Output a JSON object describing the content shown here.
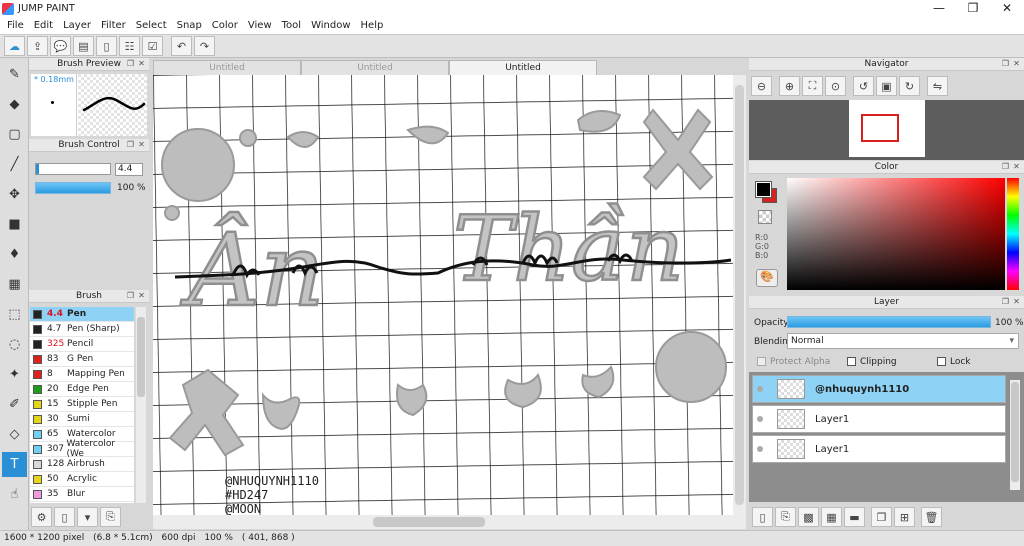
{
  "app": {
    "title": "JUMP PAINT"
  },
  "window_controls": {
    "minimize": "—",
    "maximize": "❐",
    "close": "✕"
  },
  "menu": [
    "File",
    "Edit",
    "Layer",
    "Filter",
    "Select",
    "Snap",
    "Color",
    "View",
    "Tool",
    "Window",
    "Help"
  ],
  "toolbar": {
    "icons": [
      "cloud-check-icon",
      "export-icon",
      "speech-bubble-icon",
      "comment-icon",
      "page-icon",
      "list-settings-icon",
      "checklist-icon",
      "undo-icon",
      "redo-icon"
    ]
  },
  "tools": [
    {
      "icon": "brush-icon",
      "glyph": "✎",
      "active": false
    },
    {
      "icon": "eraser-icon",
      "glyph": "◆",
      "active": false
    },
    {
      "icon": "rectangle-select-icon",
      "glyph": "▢",
      "active": false
    },
    {
      "icon": "line-icon",
      "glyph": "╱",
      "active": false
    },
    {
      "icon": "move-icon",
      "glyph": "✥",
      "active": false
    },
    {
      "icon": "fill-rect-icon",
      "glyph": "■",
      "active": false
    },
    {
      "icon": "bucket-icon",
      "glyph": "♦",
      "active": false
    },
    {
      "icon": "gradient-icon",
      "glyph": "▦",
      "active": false
    },
    {
      "icon": "select-rect-icon",
      "glyph": "⬚",
      "active": false
    },
    {
      "icon": "lasso-icon",
      "glyph": "◌",
      "active": false
    },
    {
      "icon": "magic-wand-icon",
      "glyph": "✦",
      "active": false
    },
    {
      "icon": "select-pen-icon",
      "glyph": "✐",
      "active": false
    },
    {
      "icon": "select-eraser-icon",
      "glyph": "◇",
      "active": false
    },
    {
      "icon": "text-icon",
      "glyph": "T",
      "active": true
    },
    {
      "icon": "hand-icon",
      "glyph": "☝",
      "active": false
    }
  ],
  "brush_preview": {
    "title": "Brush Preview",
    "size": "* 0.18mm"
  },
  "brush_control": {
    "title": "Brush Control",
    "size_value": "4.4",
    "opacity_value": "100 %"
  },
  "brush": {
    "title": "Brush",
    "items": [
      {
        "size": "4.4",
        "name": "Pen",
        "color": "#222222",
        "selected": true,
        "size_red": true
      },
      {
        "size": "4.7",
        "name": "Pen (Sharp)",
        "color": "#222222",
        "selected": false,
        "size_red": false
      },
      {
        "size": "325",
        "name": "Pencil",
        "color": "#222222",
        "selected": false,
        "size_red": true
      },
      {
        "size": "83",
        "name": "G Pen",
        "color": "#e0201a",
        "selected": false,
        "size_red": false
      },
      {
        "size": "8",
        "name": "Mapping Pen",
        "color": "#e0201a",
        "selected": false,
        "size_red": false
      },
      {
        "size": "20",
        "name": "Edge Pen",
        "color": "#1a9e1a",
        "selected": false,
        "size_red": false
      },
      {
        "size": "15",
        "name": "Stipple Pen",
        "color": "#e6d61a",
        "selected": false,
        "size_red": false
      },
      {
        "size": "30",
        "name": "Sumi",
        "color": "#e6d61a",
        "selected": false,
        "size_red": false
      },
      {
        "size": "65",
        "name": "Watercolor",
        "color": "#6fd0f0",
        "selected": false,
        "size_red": false
      },
      {
        "size": "307",
        "name": "Watercolor (We",
        "color": "#6fd0f0",
        "selected": false,
        "size_red": false
      },
      {
        "size": "128",
        "name": "Airbrush",
        "color": "#d8d8d8",
        "selected": false,
        "size_red": false
      },
      {
        "size": "50",
        "name": "Acrylic",
        "color": "#e6d61a",
        "selected": false,
        "size_red": false
      },
      {
        "size": "35",
        "name": "Blur",
        "color": "#f09be0",
        "selected": false,
        "size_red": false
      }
    ]
  },
  "tabs": [
    {
      "label": "Untitled",
      "active": false
    },
    {
      "label": "Untitled",
      "active": false
    },
    {
      "label": "Untitled",
      "active": true
    }
  ],
  "canvas": {
    "big_text_1": "Ân",
    "big_text_2": "Thần",
    "stamp_lines": [
      "@NHUQUYNH1110",
      "#HD247",
      "@MOON"
    ]
  },
  "navigator": {
    "title": "Navigator"
  },
  "color": {
    "title": "Color",
    "r": "R:0",
    "g": "G:0",
    "b": "B:0",
    "foreground": "#000000",
    "background": "#d42222"
  },
  "layer": {
    "title": "Layer",
    "opacity_label": "Opacity",
    "opacity_value": "100 %",
    "blending_label": "Blending",
    "blending_value": "Normal",
    "protect_alpha": "Protect Alpha",
    "clipping": "Clipping",
    "lock": "Lock",
    "items": [
      {
        "name": "@nhuquynh1110",
        "selected": true
      },
      {
        "name": "Layer1",
        "selected": false
      },
      {
        "name": "Layer1",
        "selected": false
      }
    ]
  },
  "status": {
    "pixel_size": "1600 * 1200 pixel",
    "cm_size": "(6.8 * 5.1cm)",
    "dpi": "600 dpi",
    "zoom": "100 %",
    "coords": "( 401, 868 )"
  }
}
